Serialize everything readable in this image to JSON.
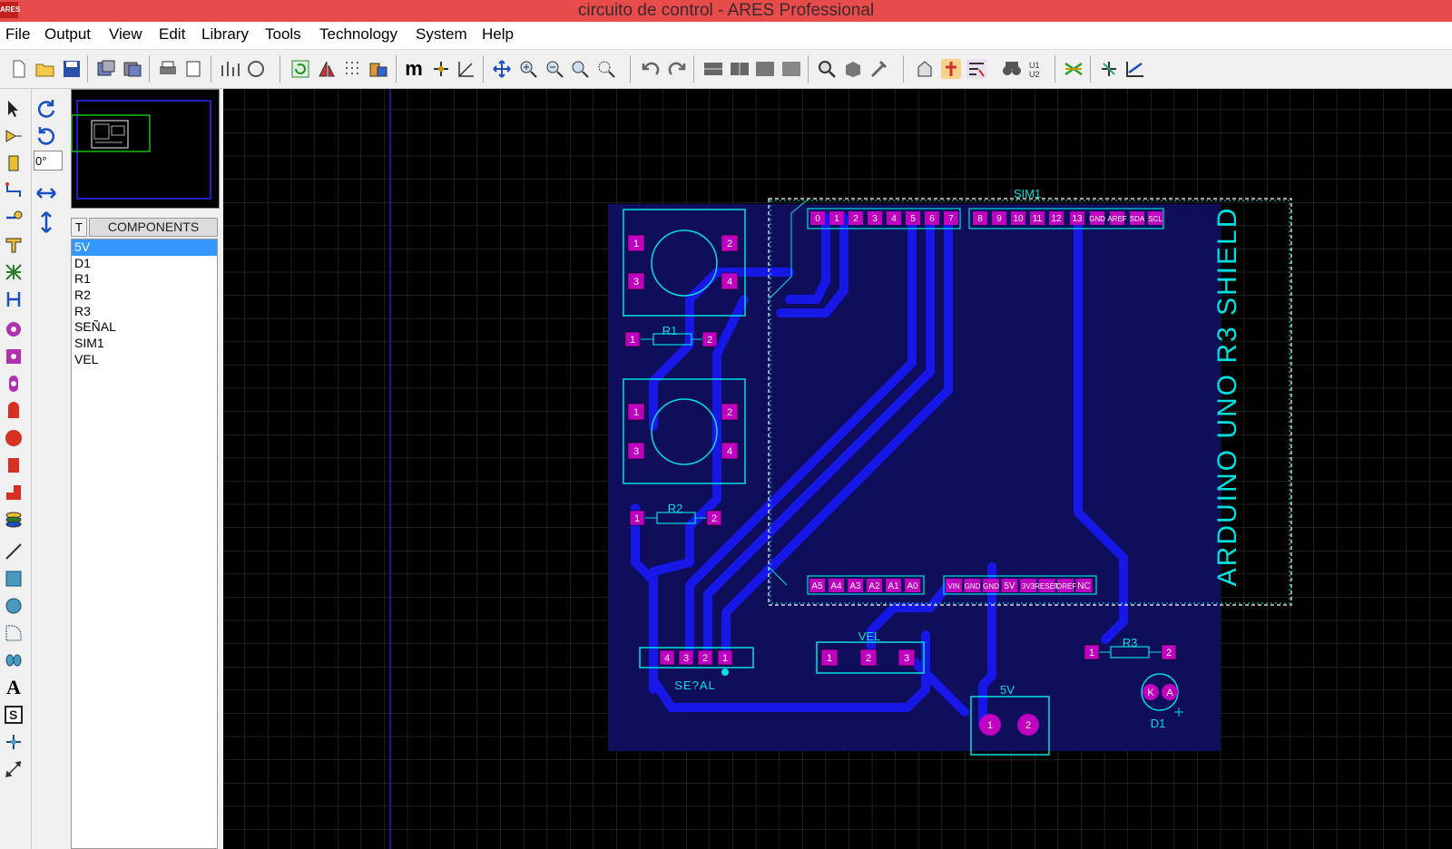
{
  "window": {
    "title": "circuito de control - ARES Professional",
    "app_icon_text": "ARES"
  },
  "menu": [
    "File",
    "Output",
    "View",
    "Edit",
    "Library",
    "Tools",
    "Technology",
    "System",
    "Help"
  ],
  "rotation": {
    "angle_value": "0°"
  },
  "components_panel": {
    "tab_label": "T",
    "header": "COMPONENTS",
    "items": [
      "5V",
      "D1",
      "R1",
      "R2",
      "R3",
      "SEÑAL",
      "SIM1",
      "VEL"
    ],
    "selected": "5V"
  },
  "pcb": {
    "labels": {
      "sim1": "SIM1",
      "shield": "ARDUINO UNO R3 SHIELD",
      "r1": "R1",
      "r2": "R2",
      "r3": "R3",
      "vel": "VEL",
      "senal": "SE?AL",
      "v5": "5V",
      "d1": "D1"
    },
    "digital_pins_a": [
      "0",
      "1",
      "2",
      "3",
      "4",
      "5",
      "6",
      "7"
    ],
    "digital_pins_b": [
      "8",
      "9",
      "10",
      "11",
      "12",
      "13",
      "GND",
      "AREF",
      "SDA",
      "SCL"
    ],
    "analog_pins": [
      "A5",
      "A4",
      "A3",
      "A2",
      "A1",
      "A0"
    ],
    "power_pins": [
      "VIN",
      "GND",
      "GND",
      "5V",
      "3V3",
      "RESET",
      "IOREF",
      "NC"
    ],
    "pads": {
      "sw_top": [
        "1",
        "2",
        "3",
        "4"
      ],
      "sw_bottom": [
        "1",
        "2",
        "3",
        "4"
      ],
      "r1": [
        "1",
        "2"
      ],
      "r2": [
        "1",
        "2"
      ],
      "r3": [
        "1",
        "2"
      ],
      "senal": [
        "4",
        "3",
        "2",
        "1"
      ],
      "vel": [
        "1",
        "2",
        "3"
      ],
      "v5": [
        "1",
        "2"
      ],
      "d1": [
        "K",
        "A"
      ]
    }
  },
  "colors": {
    "titlebar": "#e84b4b",
    "canvas": "#000000",
    "grid": "#3a3a3a",
    "board": "#0e0e5a",
    "trace": "#1717e8",
    "silk": "#00e0e0",
    "pad": "#c000c0",
    "selected": "#3399ff"
  }
}
